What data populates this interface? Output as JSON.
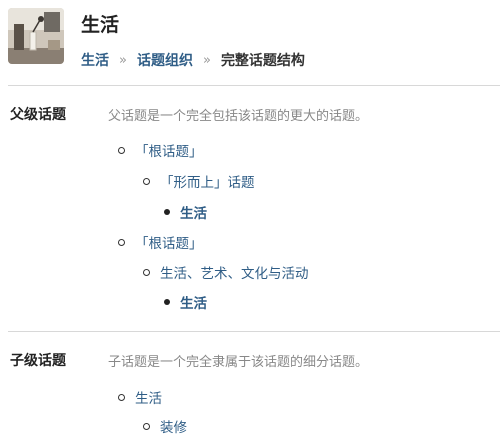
{
  "header": {
    "title": "生活",
    "thumbnail_icon": "desk-lamp-photo",
    "breadcrumb": {
      "items": [
        "生活",
        "话题组织"
      ],
      "separator": "»",
      "current": "完整话题结构"
    }
  },
  "parent_section": {
    "label": "父级话题",
    "description": "父话题是一个完全包括该话题的更大的话题。",
    "groups": [
      {
        "root": "「根话题」",
        "child": "「形而上」话题",
        "leaf": "生活"
      },
      {
        "root": "「根话题」",
        "child": "生活、艺术、文化与活动",
        "leaf": "生活"
      }
    ]
  },
  "child_section": {
    "label": "子级话题",
    "description": "子话题是一个完全隶属于该话题的细分话题。",
    "root": "生活",
    "child": "装修"
  },
  "colors": {
    "link": "#2f5d86",
    "muted": "#888888",
    "divider": "#d8d8d8"
  }
}
